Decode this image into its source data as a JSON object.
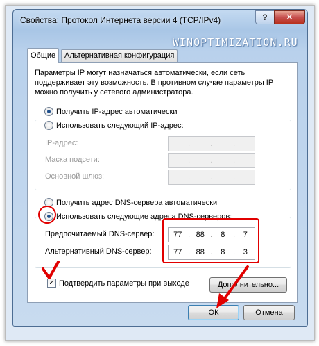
{
  "window": {
    "title": "Свойства: Протокол Интернета версии 4 (TCP/IPv4)",
    "help_label": "?",
    "close_label": "✕"
  },
  "watermark": "WINOPTIMIZATION.RU",
  "tabs": [
    {
      "label": "Общие",
      "active": true
    },
    {
      "label": "Альтернативная конфигурация",
      "active": false
    }
  ],
  "description": "Параметры IP могут назначаться автоматически, если сеть поддерживает эту возможность. В противном случае параметры IP можно получить у сетевого администратора.",
  "ip_section": {
    "auto_label": "Получить IP-адрес автоматически",
    "auto_checked": true,
    "manual_label": "Использовать следующий IP-адрес:",
    "manual_checked": false,
    "fields": [
      {
        "label": "IP-адрес:",
        "value": [
          "",
          "",
          "",
          ""
        ]
      },
      {
        "label": "Маска подсети:",
        "value": [
          "",
          "",
          "",
          ""
        ]
      },
      {
        "label": "Основной шлюз:",
        "value": [
          "",
          "",
          "",
          ""
        ]
      }
    ]
  },
  "dns_section": {
    "auto_label": "Получить адрес DNS-сервера автоматически",
    "auto_checked": false,
    "manual_label": "Использовать следующие адреса DNS-серверов:",
    "manual_checked": true,
    "preferred": {
      "label": "Предпочитаемый DNS-сервер:",
      "octets": [
        "77",
        "88",
        "8",
        "7"
      ]
    },
    "alternate": {
      "label": "Альтернативный DNS-сервер:",
      "octets": [
        "77",
        "88",
        "8",
        "3"
      ]
    }
  },
  "validate": {
    "label": "Подтвердить параметры при выходе",
    "checked": true
  },
  "buttons": {
    "advanced": "Дополнительно...",
    "ok": "ОК",
    "cancel": "Отмена"
  },
  "colors": {
    "annotation_red": "#e10000",
    "accent_blue": "#1e4f8c"
  }
}
